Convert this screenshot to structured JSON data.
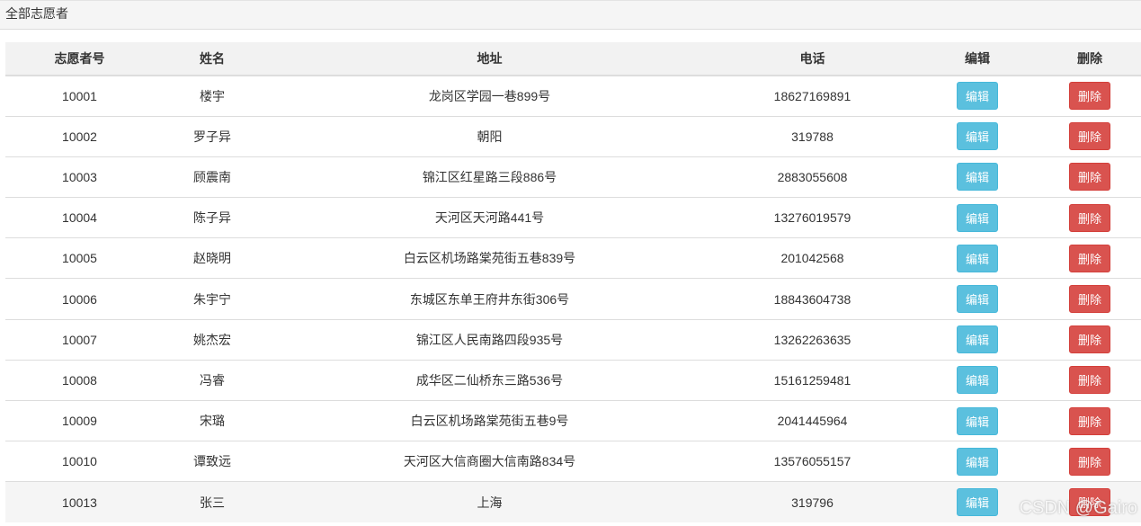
{
  "panel": {
    "title": "全部志愿者"
  },
  "table": {
    "headers": [
      "志愿者号",
      "姓名",
      "地址",
      "电话",
      "编辑",
      "删除"
    ],
    "rows": [
      {
        "id": "10001",
        "name": "楼宇",
        "address": "龙岗区学园一巷899号",
        "phone": "18627169891",
        "edit": "编辑",
        "delete": "删除"
      },
      {
        "id": "10002",
        "name": "罗子异",
        "address": "朝阳",
        "phone": "319788",
        "edit": "编辑",
        "delete": "删除"
      },
      {
        "id": "10003",
        "name": "顾震南",
        "address": "锦江区红星路三段886号",
        "phone": "2883055608",
        "edit": "编辑",
        "delete": "删除"
      },
      {
        "id": "10004",
        "name": "陈子异",
        "address": "天河区天河路441号",
        "phone": "13276019579",
        "edit": "编辑",
        "delete": "删除"
      },
      {
        "id": "10005",
        "name": "赵晓明",
        "address": "白云区机场路棠苑街五巷839号",
        "phone": "201042568",
        "edit": "编辑",
        "delete": "删除"
      },
      {
        "id": "10006",
        "name": "朱宇宁",
        "address": "东城区东单王府井东街306号",
        "phone": "18843604738",
        "edit": "编辑",
        "delete": "删除"
      },
      {
        "id": "10007",
        "name": "姚杰宏",
        "address": "锦江区人民南路四段935号",
        "phone": "13262263635",
        "edit": "编辑",
        "delete": "删除"
      },
      {
        "id": "10008",
        "name": "冯睿",
        "address": "成华区二仙桥东三路536号",
        "phone": "15161259481",
        "edit": "编辑",
        "delete": "删除"
      },
      {
        "id": "10009",
        "name": "宋璐",
        "address": "白云区机场路棠苑街五巷9号",
        "phone": "2041445964",
        "edit": "编辑",
        "delete": "删除"
      },
      {
        "id": "10010",
        "name": "谭致远",
        "address": "天河区大信商圈大信南路834号",
        "phone": "13576055157",
        "edit": "编辑",
        "delete": "删除"
      },
      {
        "id": "10013",
        "name": "张三",
        "address": "上海",
        "phone": "319796",
        "edit": "编辑",
        "delete": "删除"
      }
    ]
  },
  "watermark": "CSDN @Gairo",
  "colors": {
    "edit_button": "#5bc0de",
    "delete_button": "#d9534f",
    "header_bg": "#f2f2f2"
  }
}
